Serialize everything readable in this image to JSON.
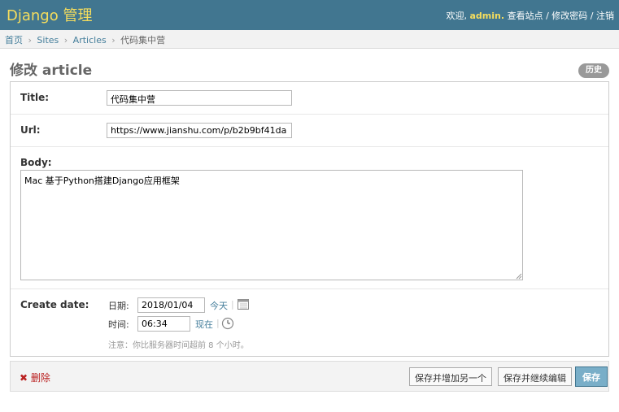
{
  "header": {
    "brand": "Django 管理",
    "welcome": "欢迎,",
    "username": "admin",
    "username_dot": ".",
    "view_site": "查看站点",
    "change_password": "修改密码",
    "logout": "注销",
    "separator": "/"
  },
  "breadcrumbs": {
    "items": [
      "首页",
      "Sites",
      "Articles",
      "代码集中营"
    ],
    "separator": "›"
  },
  "page": {
    "title": "修改 article",
    "history_label": "历史"
  },
  "form": {
    "title_label": "Title:",
    "title_value": "代码集中营",
    "url_label": "Url:",
    "url_value": "https://www.jianshu.com/p/b2b9bf41da",
    "body_label": "Body:",
    "body_value": "Mac 基于Python搭建Django应用框架",
    "create_date_label": "Create date:",
    "date_label": "日期:",
    "date_value": "2018/01/04",
    "today_link": "今天",
    "time_label": "时间:",
    "time_value": "06:34",
    "now_link": "现在",
    "pipe": "|",
    "tz_note": "注意：你比服务器时间超前 8 个小时。"
  },
  "submit": {
    "delete_icon": "✖",
    "delete_label": "删除",
    "save_add_another": "保存并增加另一个",
    "save_continue": "保存并继续编辑",
    "save": "保存"
  },
  "icons": {
    "calendar": "calendar-icon",
    "clock": "clock-icon"
  },
  "colors": {
    "header_bg": "#417690",
    "brand": "#f5dd5d",
    "link": "#447e9b",
    "delete": "#ba2121",
    "save_bg": "#79aec8"
  }
}
